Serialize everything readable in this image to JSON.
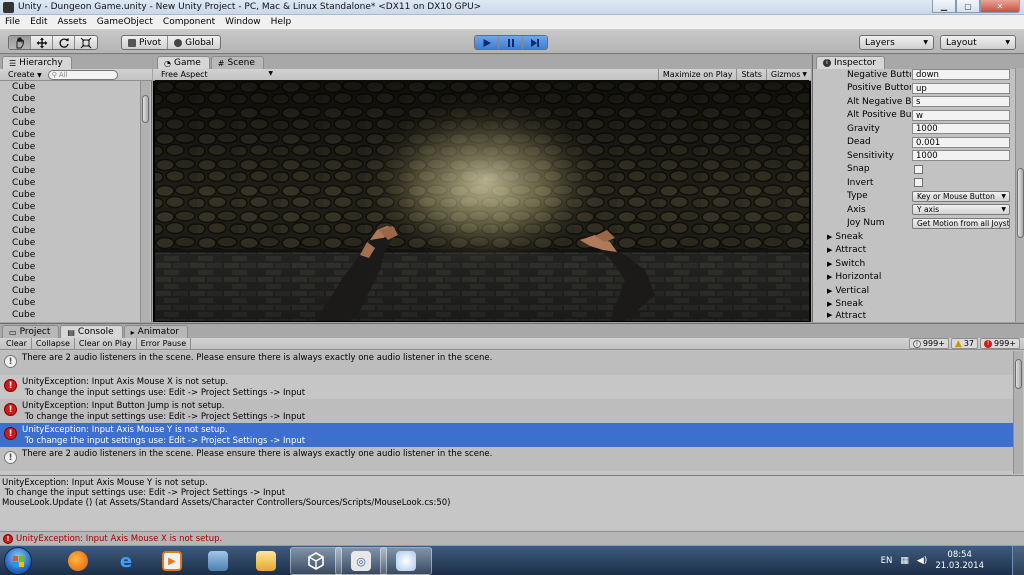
{
  "window": {
    "title": "Unity - Dungeon Game.unity - New Unity Project - PC, Mac & Linux Standalone* <DX11 on DX10 GPU>",
    "minimize": "▁",
    "maximize": "▢",
    "close": "✕"
  },
  "menu": [
    "File",
    "Edit",
    "Assets",
    "GameObject",
    "Component",
    "Window",
    "Help"
  ],
  "toolbar": {
    "pivot_label": "Pivot",
    "global_label": "Global",
    "layers_label": "Layers",
    "layout_label": "Layout"
  },
  "hierarchy": {
    "tab_label": "Hierarchy",
    "create_label": "Create",
    "search_placeholder": "All",
    "items": [
      "Cube",
      "Cube",
      "Cube",
      "Cube",
      "Cube",
      "Cube",
      "Cube",
      "Cube",
      "Cube",
      "Cube",
      "Cube",
      "Cube",
      "Cube",
      "Cube",
      "Cube",
      "Cube",
      "Cube",
      "Cube",
      "Cube",
      "Cube"
    ]
  },
  "game": {
    "tab_game": "Game",
    "tab_scene": "Scene",
    "aspect_label": "Free Aspect",
    "maximize_on_play": "Maximize on Play",
    "stats": "Stats",
    "gizmos": "Gizmos"
  },
  "inspector": {
    "tab_label": "Inspector",
    "rows": [
      {
        "label": "Negative Button",
        "value": "down",
        "kind": "field"
      },
      {
        "label": "Positive Button",
        "value": "up",
        "kind": "field"
      },
      {
        "label": "Alt Negative Button",
        "value": "s",
        "kind": "field"
      },
      {
        "label": "Alt Positive Button",
        "value": "w",
        "kind": "field"
      },
      {
        "label": "Gravity",
        "value": "1000",
        "kind": "field"
      },
      {
        "label": "Dead",
        "value": "0.001",
        "kind": "field"
      },
      {
        "label": "Sensitivity",
        "value": "1000",
        "kind": "field"
      },
      {
        "label": "Snap",
        "value": "",
        "kind": "check"
      },
      {
        "label": "Invert",
        "value": "",
        "kind": "check"
      },
      {
        "label": "Type",
        "value": "Key or Mouse Button",
        "kind": "drop"
      },
      {
        "label": "Axis",
        "value": "Y axis",
        "kind": "drop"
      },
      {
        "label": "Joy Num",
        "value": "Get Motion from all Joysticks",
        "kind": "drop"
      }
    ],
    "foldouts": [
      "Sneak",
      "Attract",
      "Switch",
      "Horizontal",
      "Vertical",
      "Sneak",
      "Attract"
    ]
  },
  "bottom_tabs": {
    "project": "Project",
    "console": "Console",
    "animator": "Animator"
  },
  "console": {
    "clear": "Clear",
    "collapse": "Collapse",
    "clear_on_play": "Clear on Play",
    "error_pause": "Error Pause",
    "count_info": "999+",
    "count_warn": "37",
    "count_error": "999+",
    "entries": [
      {
        "type": "info",
        "text": "There are 2 audio listeners in the scene. Please ensure there is always exactly one audio listener in the scene.",
        "selected": false
      },
      {
        "type": "error",
        "text": "UnityException: Input Axis Mouse X is not setup.\n To change the input settings use: Edit -> Project Settings -> Input",
        "selected": false
      },
      {
        "type": "error",
        "text": "UnityException: Input Button Jump is not setup.\n To change the input settings use: Edit -> Project Settings -> Input",
        "selected": false
      },
      {
        "type": "error",
        "text": "UnityException: Input Axis Mouse Y is not setup.\n To change the input settings use: Edit -> Project Settings -> Input",
        "selected": true
      },
      {
        "type": "info",
        "text": "There are 2 audio listeners in the scene. Please ensure there is always exactly one audio listener in the scene.",
        "selected": false
      }
    ],
    "detail": [
      "UnityException: Input Axis Mouse Y is not setup.",
      " To change the input settings use: Edit -> Project Settings -> Input",
      "MouseLook.Update () (at Assets/Standard Assets/Character Controllers/Sources/Scripts/MouseLook.cs:50)"
    ],
    "status": "UnityException: Input Axis Mouse X is not setup."
  },
  "taskbar": {
    "language": "EN",
    "time": "08:54",
    "date": "21.03.2014"
  },
  "colors": {
    "selection": "#3d6fcf",
    "error_red": "#d01a1a",
    "play_blue": "#3b7ed6"
  }
}
